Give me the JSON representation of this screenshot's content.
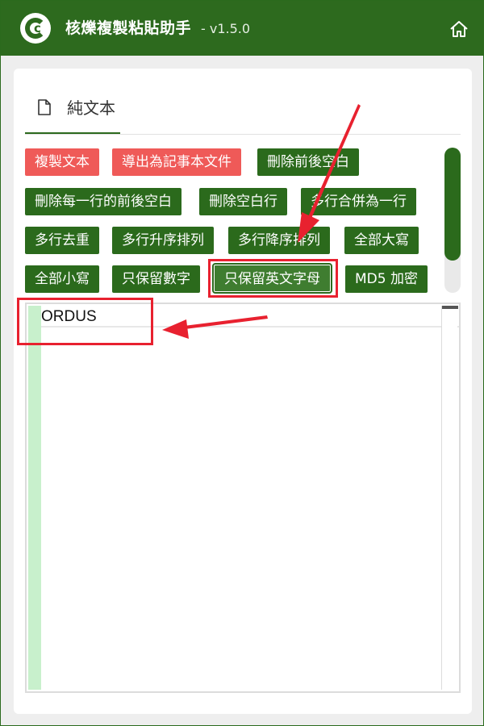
{
  "app": {
    "title": "核爍複製粘貼助手",
    "version": "- v1.5.0",
    "logo_letter": "c"
  },
  "tab": {
    "label": "純文本"
  },
  "buttons": {
    "copy_text": "複製文本",
    "export_notepad": "導出為記事本文件",
    "trim_all": "刪除前後空白",
    "trim_each_line": "刪除每一行的前後空白",
    "remove_blank_lines": "刪除空白行",
    "merge_lines": "多行合併為一行",
    "dedupe_lines": "多行去重",
    "sort_asc": "多行升序排列",
    "sort_desc": "多行降序排列",
    "uppercase": "全部大寫",
    "lowercase": "全部小寫",
    "keep_digits": "只保留數字",
    "keep_letters": "只保留英文字母",
    "md5": "MD5 加密"
  },
  "editor": {
    "lines": [
      "ORDUS"
    ]
  },
  "colors": {
    "brand_green": "#2d6a1e",
    "red_button": "#ef5a58",
    "annotation_red": "#e8212f"
  }
}
